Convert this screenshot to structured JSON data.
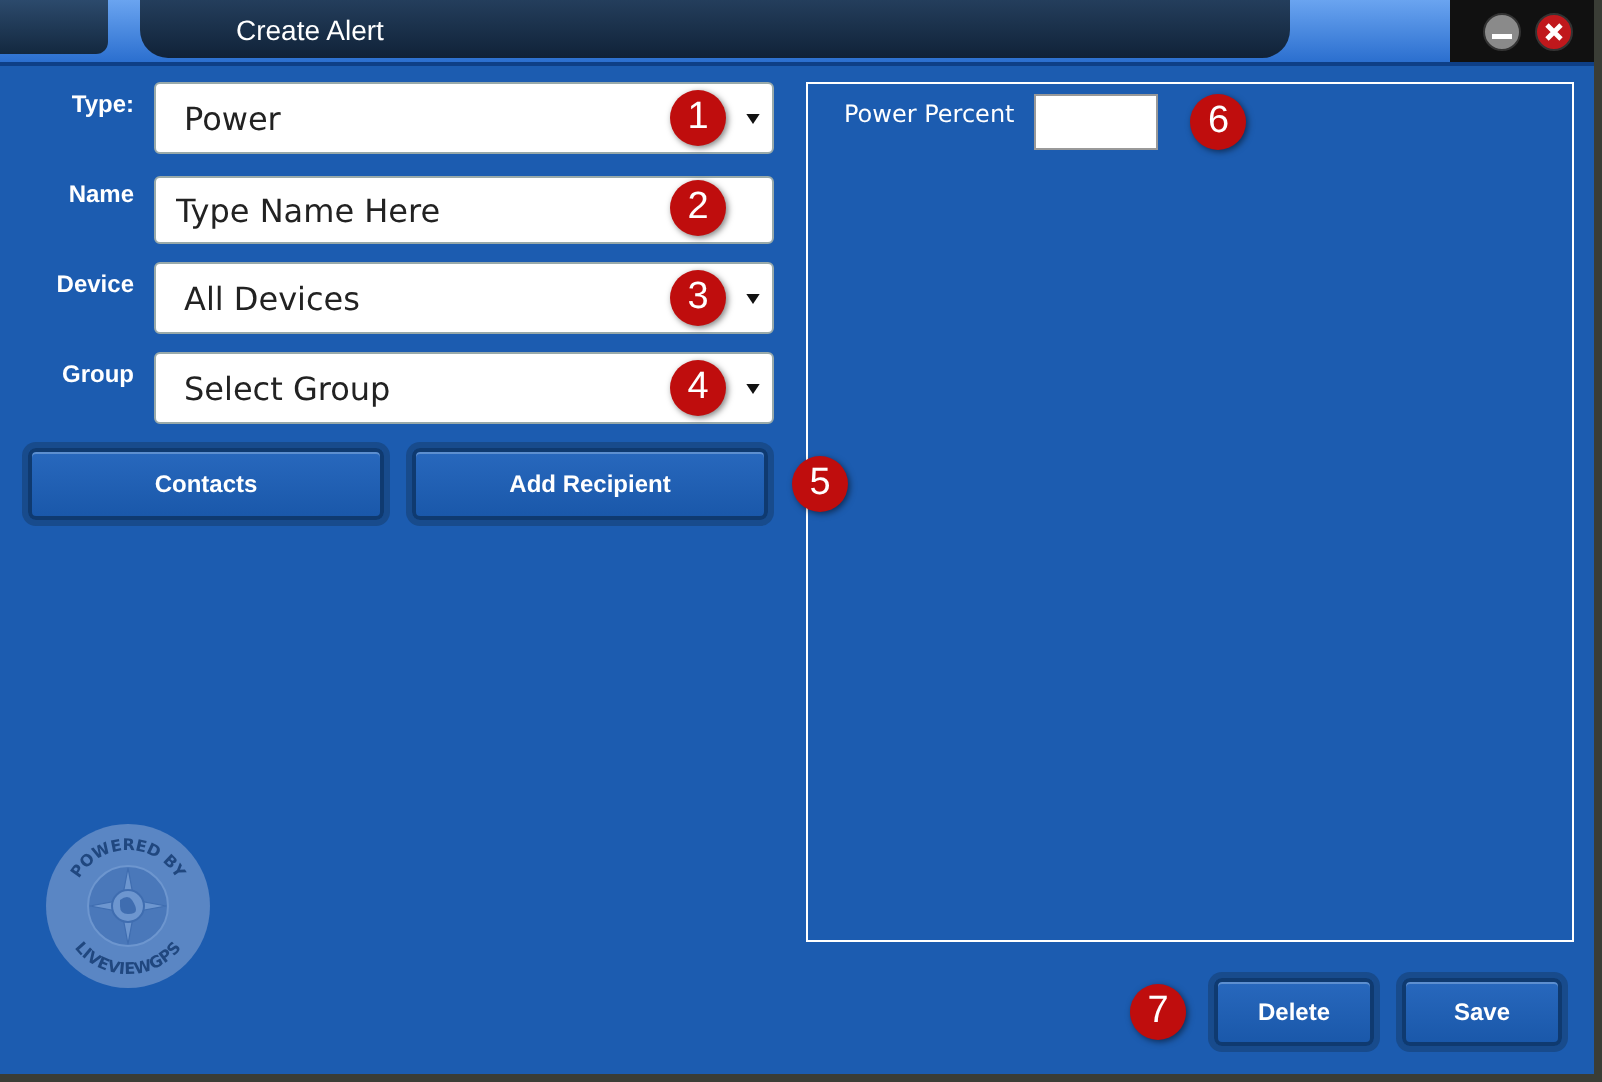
{
  "window": {
    "title": "Create Alert"
  },
  "form": {
    "fields": [
      {
        "kind": "dropdown",
        "label": "Type:",
        "value": "Power",
        "marker": "1"
      },
      {
        "kind": "text",
        "label": "Name",
        "placeholder": "Type Name Here",
        "marker": "2"
      },
      {
        "kind": "dropdown",
        "label": "Device",
        "value": "All Devices",
        "marker": "3"
      },
      {
        "kind": "dropdown",
        "label": "Group",
        "value": "Select Group",
        "marker": "4"
      }
    ],
    "buttons": [
      "Contacts",
      "Add Recipient"
    ],
    "buttons_marker": "5"
  },
  "settings_panel": {
    "fields": [
      {
        "label": "Power Percent",
        "marker": "6"
      }
    ]
  },
  "footer": {
    "marker": "7",
    "buttons": [
      "Delete",
      "Save"
    ]
  },
  "logo": {
    "top_text": "POWERED BY",
    "bottom_text": "LIVEVIEWGPS"
  }
}
